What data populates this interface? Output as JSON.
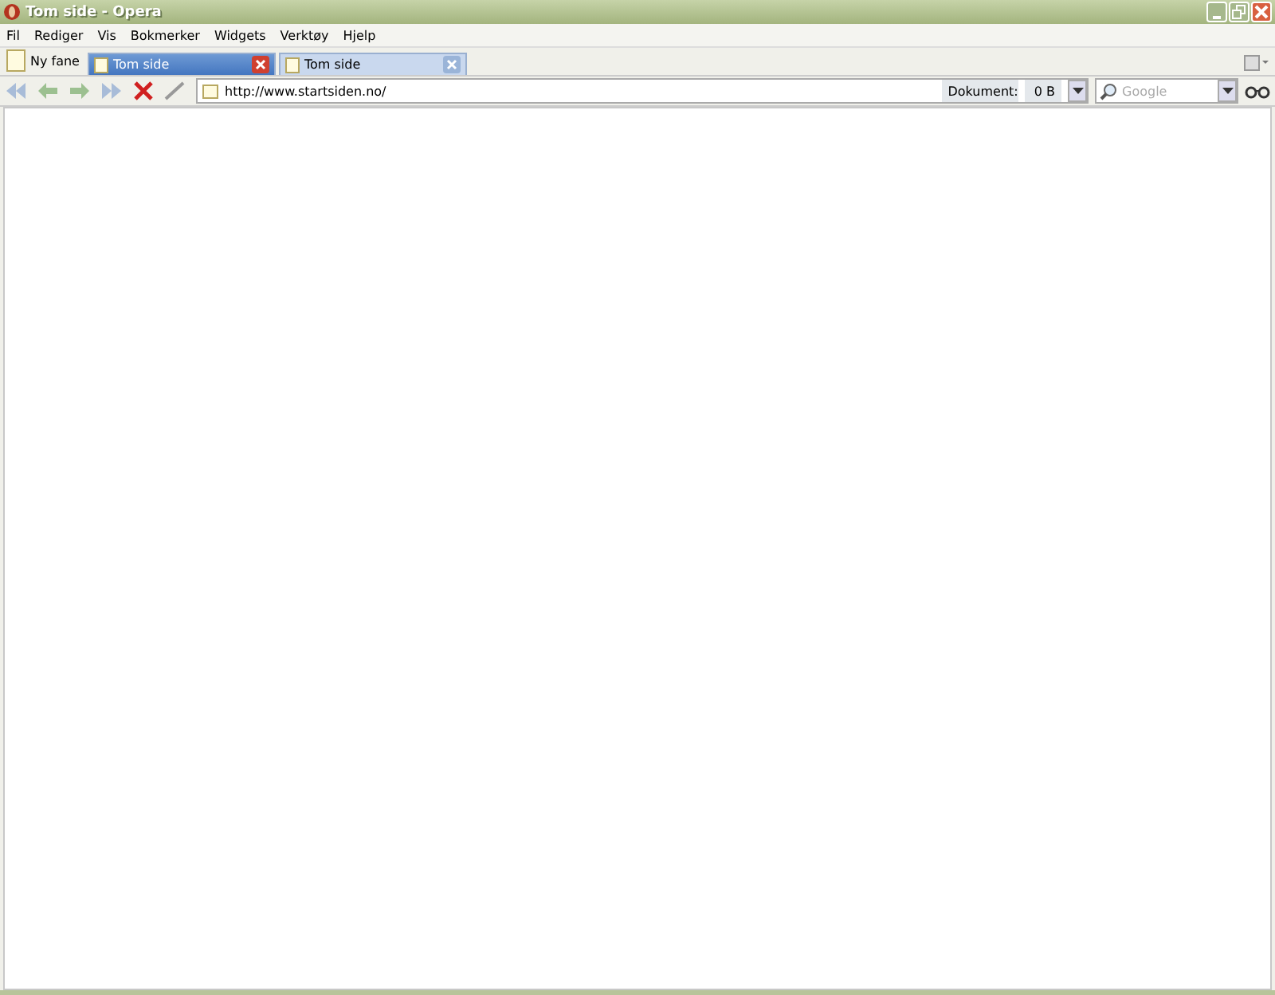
{
  "window": {
    "title": "Tom side - Opera"
  },
  "menu": [
    "Fil",
    "Rediger",
    "Vis",
    "Bokmerker",
    "Widgets",
    "Verktøy",
    "Hjelp"
  ],
  "new_tab": "Ny fane",
  "tabs": [
    {
      "label": "Tom side",
      "selected": true
    },
    {
      "label": "Tom side",
      "selected": false
    }
  ],
  "address": {
    "value": "http://www.startsiden.no/"
  },
  "document_size": {
    "label": "Dokument:",
    "value": "0 B"
  },
  "search": {
    "placeholder": "Google"
  }
}
